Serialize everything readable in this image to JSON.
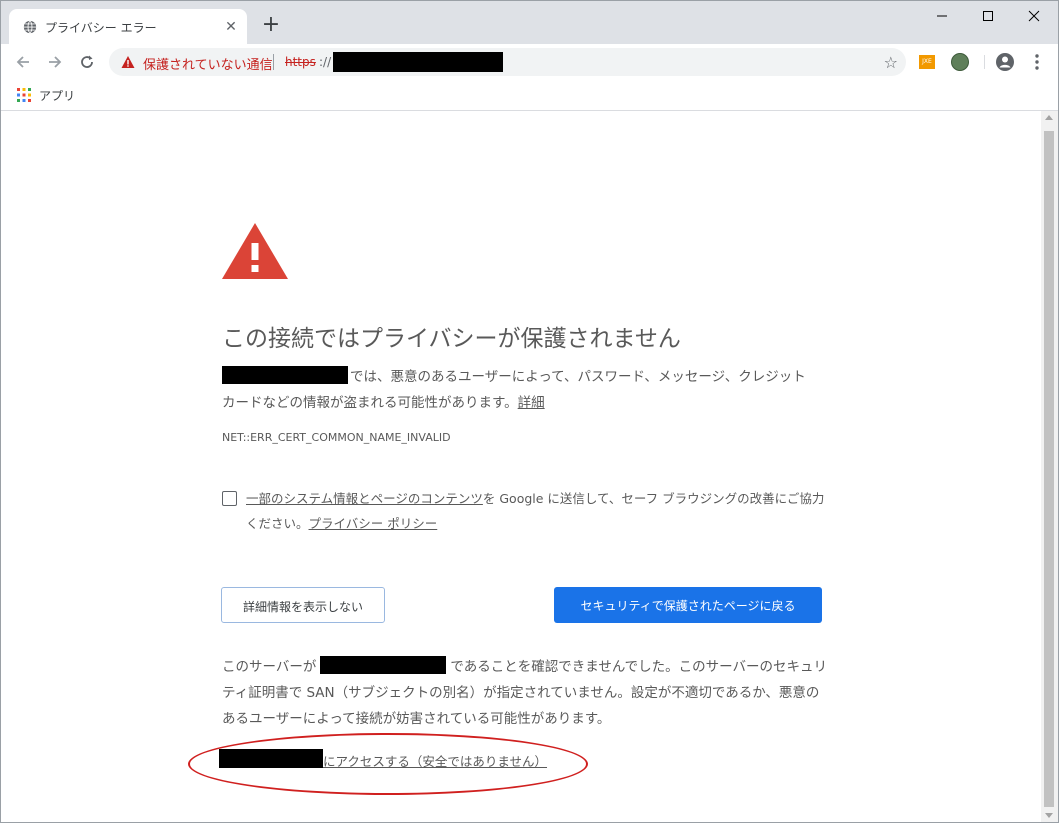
{
  "browser": {
    "tab_title": "プライバシー エラー",
    "tab_close": "✕",
    "new_tab": "+",
    "omnibox": {
      "insecure_label": "保護されていない通信",
      "url_scheme": "https",
      "url_sep": "://"
    },
    "bookmarks": {
      "apps_label": "アプリ"
    },
    "extension_badge": "JXE"
  },
  "page": {
    "heading": "この接続ではプライバシーが保護されません",
    "intro_text": "では、悪意のあるユーザーによって、パスワード、メッセージ、クレジット カードなどの情報が盗まれる可能性があります。",
    "intro_link": "詳細",
    "error_code": "NET::ERR_CERT_COMMON_NAME_INVALID",
    "optin": {
      "link1": "一部のシステム情報とページのコンテンツ",
      "text1": "を Google に送信して、セーフ ブラウジングの改善にご協力ください。",
      "link2": "プライバシー ポリシー"
    },
    "buttons": {
      "hide_details": "詳細情報を表示しない",
      "back_to_safety": "セキュリティで保護されたページに戻る"
    },
    "details": {
      "prefix": "このサーバーが",
      "suffix": "であることを確認できませんでした。このサーバーのセキュリティ証明書で SAN（サブジェクトの別名）が指定されていません。設定が不適切であるか、悪意のあるユーザーによって接続が妨害されている可能性があります。"
    },
    "proceed_link": "にアクセスする（安全ではありません）"
  },
  "colors": {
    "accent_blue": "#1a73e8",
    "warning_red": "#db4437",
    "insecure_red": "#c5221f",
    "annotation_red": "#d0201f"
  }
}
